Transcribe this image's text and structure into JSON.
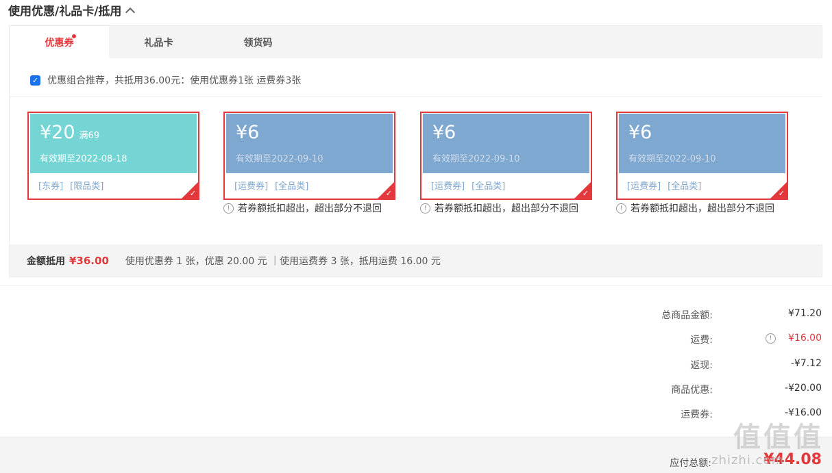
{
  "section": {
    "title": "使用优惠/礼品卡/抵用"
  },
  "tabs": [
    {
      "label": "优惠券"
    },
    {
      "label": "礼品卡"
    },
    {
      "label": "领货码"
    }
  ],
  "combo": {
    "text": "优惠组合推荐，共抵用36.00元：使用优惠券1张 运费券3张",
    "checked": true
  },
  "coupons": [
    {
      "amount": "¥20",
      "condition": "满69",
      "date": "有效期至2022-08-18",
      "tags": [
        "[东券]",
        "[限品类]"
      ],
      "color": "#75d5d5",
      "warning": ""
    },
    {
      "amount": "¥6",
      "condition": "",
      "date": "有效期至2022-09-10",
      "tags": [
        "[运费券]",
        "[全品类]"
      ],
      "color": "#7fa8d0",
      "warning": "若券额抵扣超出，超出部分不退回"
    },
    {
      "amount": "¥6",
      "condition": "",
      "date": "有效期至2022-09-10",
      "tags": [
        "[运费券]",
        "[全品类]"
      ],
      "color": "#7fa8d0",
      "warning": "若券额抵扣超出，超出部分不退回"
    },
    {
      "amount": "¥6",
      "condition": "",
      "date": "有效期至2022-09-10",
      "tags": [
        "[运费券]",
        "[全品类]"
      ],
      "color": "#7fa8d0",
      "warning": "若券额抵扣超出，超出部分不退回"
    }
  ],
  "summary": {
    "label": "金额抵用",
    "amount": "¥36.00",
    "detail": "使用优惠券 1 张，优惠 20.00 元 ｜使用运费券 3 张，抵用运费 16.00 元"
  },
  "totals": [
    {
      "label": "总商品金额:",
      "value": "¥71.20"
    },
    {
      "label": "运费:",
      "value": "¥16.00"
    },
    {
      "label": "返现:",
      "value": "-¥7.12"
    },
    {
      "label": "商品优惠:",
      "value": "-¥20.00"
    },
    {
      "label": "运费券:",
      "value": "-¥16.00"
    }
  ],
  "payable": {
    "label": "应付总额:",
    "value": "¥44.08"
  },
  "watermark": {
    "main": "值值值",
    "sub": "zhizhi.com"
  },
  "colors": {
    "accent": "#e4393c",
    "teal": "#75d5d5",
    "blue": "#7fa8d0"
  }
}
